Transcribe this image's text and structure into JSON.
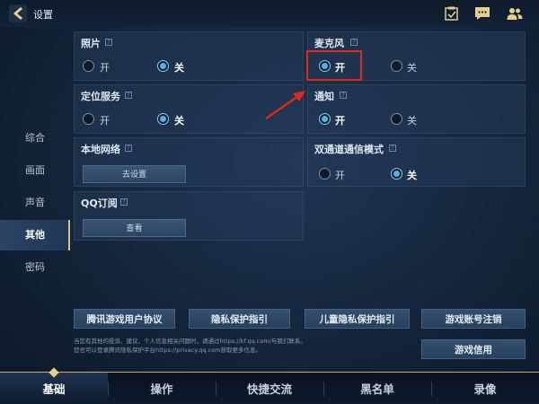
{
  "header": {
    "title": "设置"
  },
  "sidebar": {
    "items": [
      {
        "label": "综合"
      },
      {
        "label": "画面"
      },
      {
        "label": "声音"
      },
      {
        "label": "其他"
      },
      {
        "label": "密码"
      }
    ],
    "active": "其他"
  },
  "panels": {
    "photo": {
      "title": "照片",
      "on_label": "开",
      "off_label": "关",
      "selected": "off"
    },
    "microphone": {
      "title": "麦克风",
      "on_label": "开",
      "off_label": "关",
      "selected": "on"
    },
    "location": {
      "title": "定位服务",
      "on_label": "开",
      "off_label": "关",
      "selected": "off"
    },
    "notification": {
      "title": "通知",
      "on_label": "开",
      "off_label": "关",
      "selected": "on"
    },
    "local_network": {
      "title": "本地网络",
      "button_label": "去设置"
    },
    "dual_channel": {
      "title": "双通道通信模式",
      "on_label": "开",
      "off_label": "关",
      "selected": "off"
    },
    "qq_subscription": {
      "title": "QQ订阅",
      "button_label": "查看"
    }
  },
  "help_glyph": "?",
  "links": {
    "user_agreement": "腾讯游戏用户协议",
    "privacy_guide": "隐私保护指引",
    "child_privacy": "儿童隐私保护指引",
    "account_cancel": "游戏账号注销",
    "game_credit": "游戏信用"
  },
  "notice": {
    "line1": "当您有其他的投诉、建议、个人信息相关问题时，请通过https://kf.qq.com/与我们联系。",
    "line2": "您也可以登录腾讯隐私保护平台https://privacy.qq.com获取更多信息。"
  },
  "bottom_tabs": [
    {
      "label": "基础"
    },
    {
      "label": "操作"
    },
    {
      "label": "快捷交流"
    },
    {
      "label": "黑名单"
    },
    {
      "label": "录像"
    }
  ],
  "colors": {
    "accent_blue": "#4fb3ea",
    "highlight_red": "#e0291e",
    "gold": "#c6ae6a"
  }
}
